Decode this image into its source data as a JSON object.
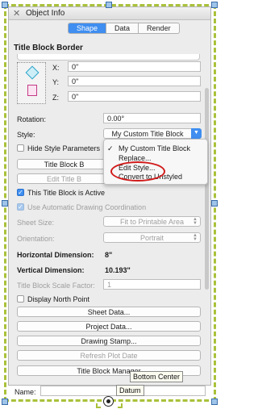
{
  "window": {
    "title": "Object Info",
    "close": "✕"
  },
  "tabs": [
    "Shape",
    "Data",
    "Render"
  ],
  "section_title": "Title Block Border",
  "coords": {
    "x_label": "X:",
    "x_value": "0\"",
    "y_label": "Y:",
    "y_value": "0\"",
    "z_label": "Z:",
    "z_value": "0\""
  },
  "rotation": {
    "label": "Rotation:",
    "value": "0.00°"
  },
  "style": {
    "label": "Style:",
    "value": "My Custom Title Block"
  },
  "hide_style_params": {
    "label": "Hide Style Parameters"
  },
  "buttons": {
    "title_block_b": "Title Block B",
    "edit_title_b": "Edit Title B",
    "sheet_data": "Sheet Data...",
    "project_data": "Project Data...",
    "drawing_stamp": "Drawing Stamp...",
    "refresh_plot_date": "Refresh Plot Date",
    "title_block_manager": "Title Block Manager"
  },
  "active": {
    "label": "This Title Block is Active"
  },
  "auto_coord": {
    "label": "Use Automatic Drawing Coordination"
  },
  "sheet_size": {
    "label": "Sheet Size:",
    "value": "Fit to Printable Area"
  },
  "orientation": {
    "label": "Orientation:",
    "value": "Portrait"
  },
  "h_dim": {
    "label": "Horizontal Dimension:",
    "value": "8\""
  },
  "v_dim": {
    "label": "Vertical Dimension:",
    "value": "10.193\""
  },
  "scale_factor": {
    "label": "Title Block Scale Factor:",
    "value": "1"
  },
  "north_point": {
    "label": "Display North Point"
  },
  "name": {
    "label": "Name:",
    "value": ""
  },
  "menu": {
    "items": [
      "My Custom Title Block",
      "Replace...",
      "Edit Style...",
      "Convert to Unstyled"
    ],
    "checked_index": 0
  },
  "tooltips": {
    "bottom_center": "Bottom Center",
    "datum": "Datum"
  },
  "colors": {
    "accent": "#3f8ef0",
    "selection": "#a9c13a",
    "highlight_ring": "#d11a1a"
  }
}
